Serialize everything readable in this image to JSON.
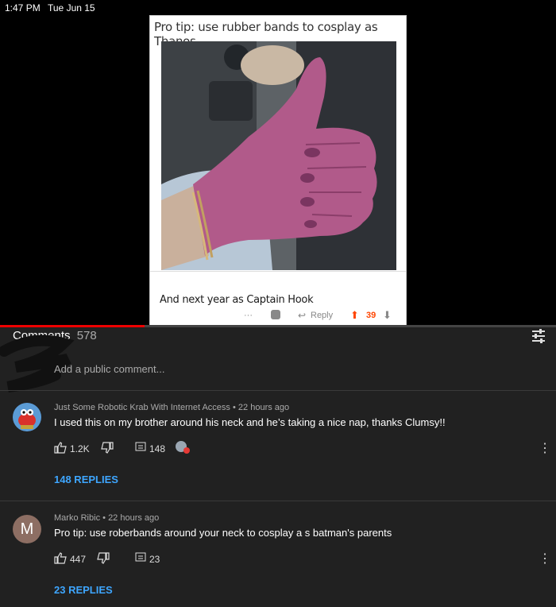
{
  "statusbar": {
    "time": "1:47 PM",
    "date": "Tue Jun 15"
  },
  "video": {
    "card_title": "Pro tip: use rubber bands to cosplay as Thanos",
    "reply_text": "And next year as Captain Hook",
    "reply_label": "Reply",
    "vote_count": "39",
    "progress": 0.26
  },
  "comments": {
    "header_label": "Comments",
    "header_count": "578",
    "add_placeholder": "Add a public comment...",
    "items": [
      {
        "author": "Just Some Robotic Krab With Internet Access",
        "time": "22 hours ago",
        "text": "I used this on my brother around his neck and he’s taking a nice nap, thanks Clumsy!!",
        "likes": "1.2K",
        "reply_count": "148",
        "replies_link": "148 REPLIES",
        "avatar_icon": "crab-avatar"
      },
      {
        "author": "Marko Ribic",
        "time": "22 hours ago",
        "text": "Pro tip: use roberbands around your neck to cosplay a s batman's parents",
        "likes": "447",
        "reply_count": "23",
        "replies_link": "23 REPLIES",
        "avatar_letter": "M",
        "avatar_color": "#8d6e63"
      }
    ]
  },
  "colors": {
    "accent_red": "#ff0000",
    "link_blue": "#3ea6ff",
    "upvote": "#ff4500"
  }
}
